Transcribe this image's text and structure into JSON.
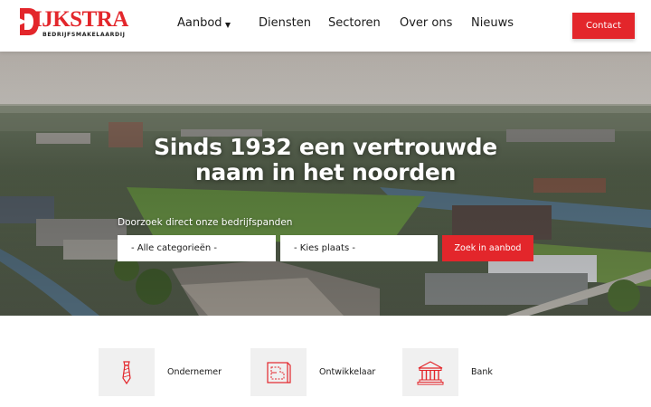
{
  "brand": {
    "name": "IJKSTRA",
    "tagline": "BEDRIJFSMAKELAARDIJ",
    "accent_color": "#e3262b"
  },
  "nav": {
    "items": [
      {
        "label": "Aanbod",
        "has_dropdown": true
      },
      {
        "label": "Diensten"
      },
      {
        "label": "Sectoren"
      },
      {
        "label": "Over ons"
      },
      {
        "label": "Nieuws"
      }
    ],
    "contact_label": "Contact"
  },
  "hero": {
    "title_line1": "Sinds 1932 een vertrouwde",
    "title_line2": "naam in het noorden",
    "search_label": "Doorzoek direct onze bedrijfspanden",
    "category_select": "- Alle categorieën -",
    "place_select": "- Kies plaats -",
    "search_button": "Zoek in aanbod"
  },
  "sectors": [
    {
      "label": "Ondernemer",
      "icon": "tie-icon"
    },
    {
      "label": "Ontwikkelaar",
      "icon": "blueprint-icon"
    },
    {
      "label": "Bank",
      "icon": "bank-icon"
    }
  ]
}
